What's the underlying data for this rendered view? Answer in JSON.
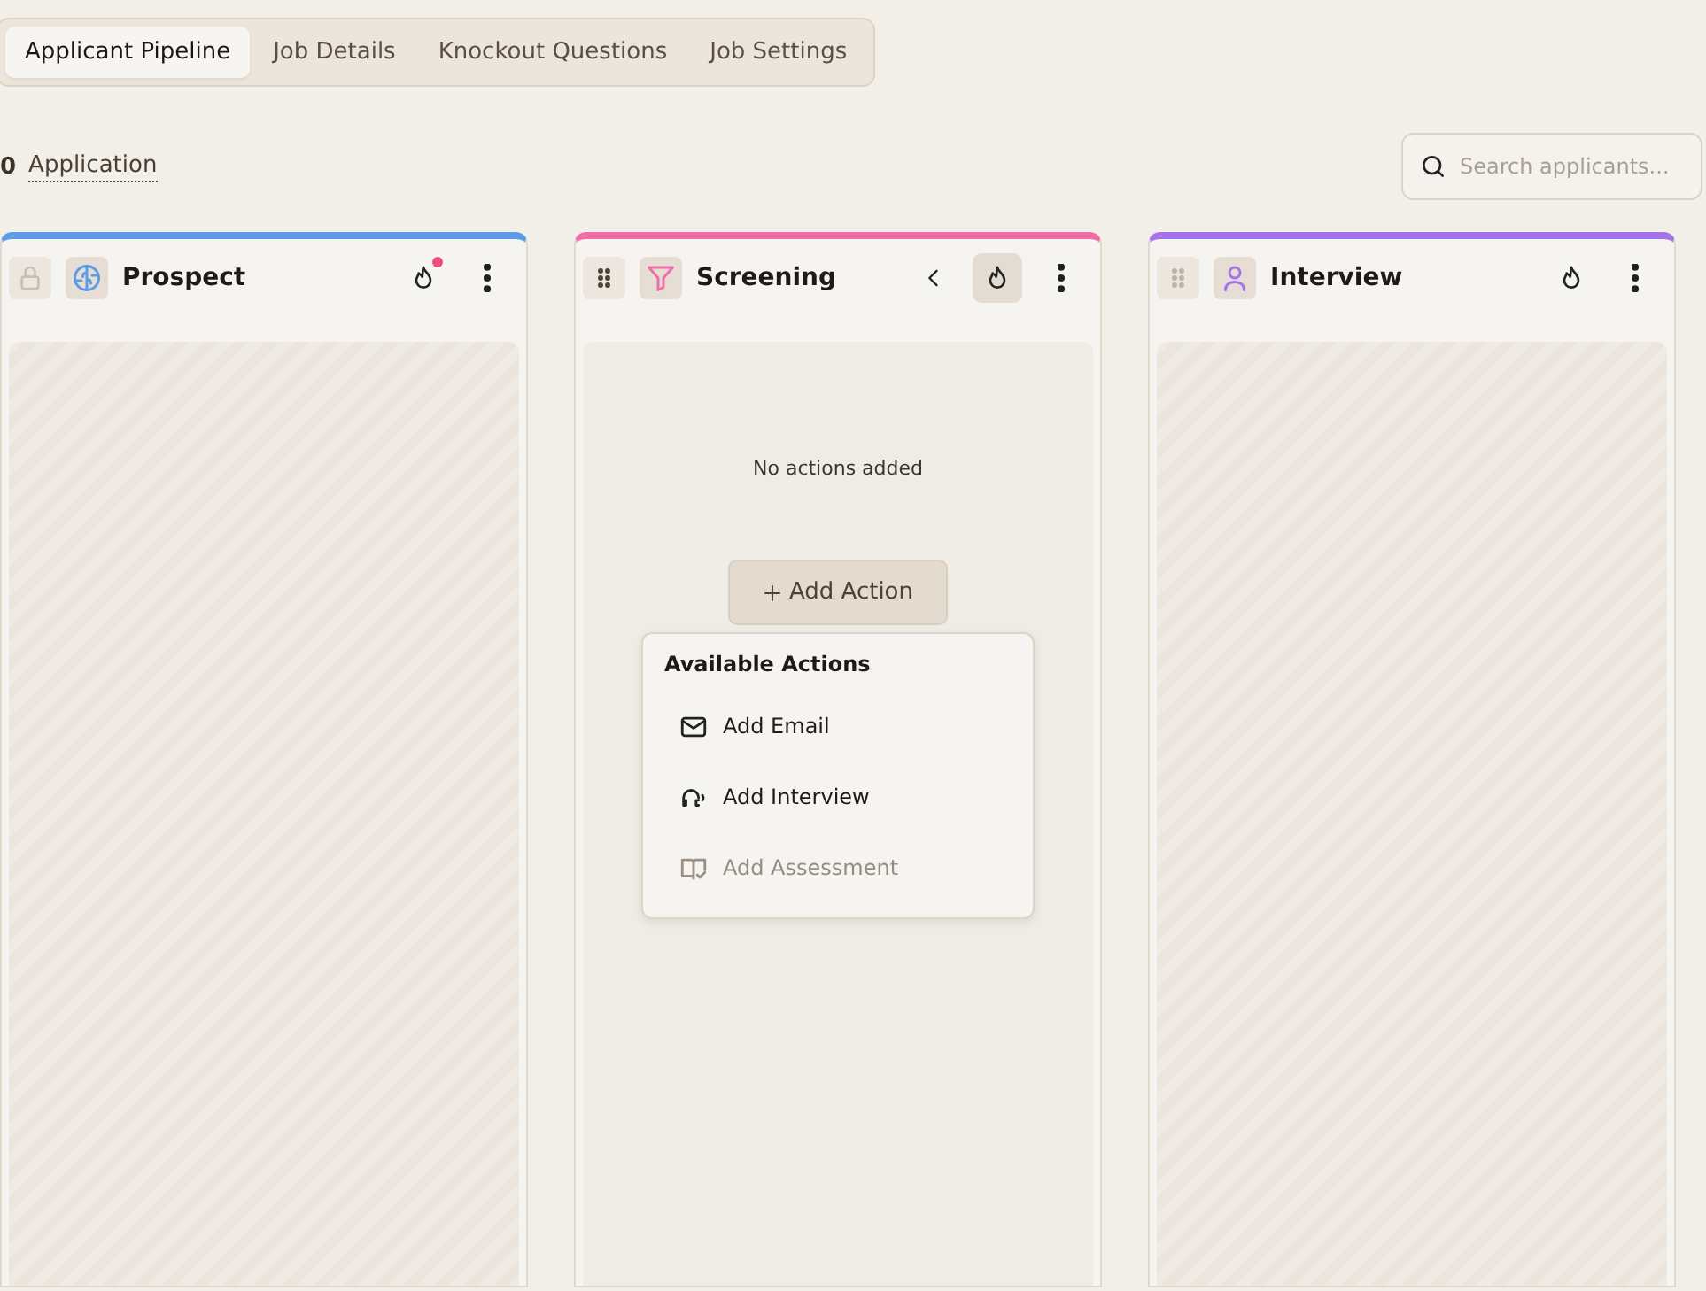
{
  "tabs": [
    {
      "label": "Applicant Pipeline",
      "selected": true
    },
    {
      "label": "Job Details",
      "selected": false
    },
    {
      "label": "Knockout Questions",
      "selected": false
    },
    {
      "label": "Job Settings",
      "selected": false
    }
  ],
  "summary": {
    "count": "0",
    "label": "Application"
  },
  "search": {
    "placeholder": "Search applicants..."
  },
  "columns": [
    {
      "title": "Prospect",
      "kind": "locked",
      "color": "#5b9be8",
      "collapse": false,
      "flame_selected": false,
      "notification": true
    },
    {
      "title": "Screening",
      "kind": "draggable",
      "color": "#ee6fa8",
      "collapse": true,
      "flame_selected": true,
      "notification": false,
      "faded_handle": false,
      "message": "No actions added",
      "add_button": "Add Action",
      "menu": {
        "title": "Available Actions",
        "items": [
          {
            "kind": "email",
            "label": "Add Email",
            "disabled": false
          },
          {
            "kind": "interview",
            "label": "Add Interview",
            "disabled": false
          },
          {
            "kind": "assessment",
            "label": "Add Assessment",
            "disabled": true
          }
        ]
      }
    },
    {
      "title": "Interview",
      "kind": "draggable",
      "color": "#a473ea",
      "collapse": false,
      "flame_selected": false,
      "notification": false,
      "faded_handle": true
    }
  ]
}
